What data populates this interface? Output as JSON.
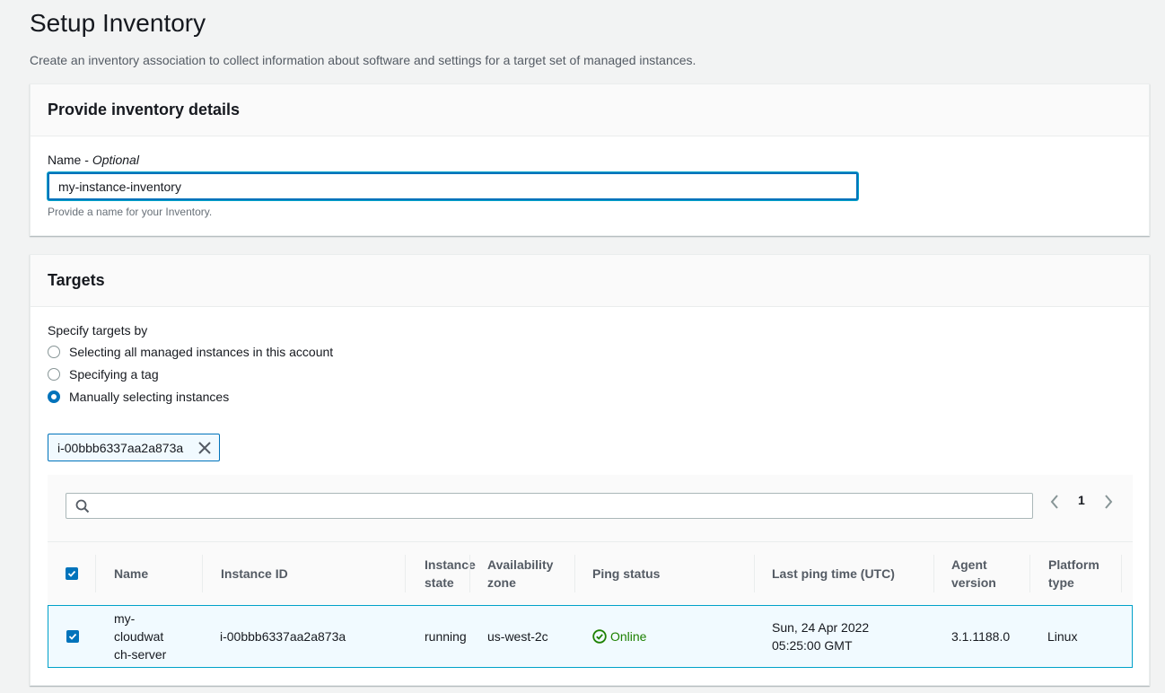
{
  "page": {
    "title": "Setup Inventory",
    "subtitle": "Create an inventory association to collect information about software and settings for a target set of managed instances."
  },
  "details": {
    "header": "Provide inventory details",
    "name_label": "Name",
    "name_label_sep": " - ",
    "name_label_optional": "Optional",
    "name_value": "my-instance-inventory",
    "name_hint": "Provide a name for your Inventory."
  },
  "targets": {
    "header": "Targets",
    "specify_label": "Specify targets by",
    "options": [
      {
        "label": "Selecting all managed instances in this account",
        "checked": false
      },
      {
        "label": "Specifying a tag",
        "checked": false
      },
      {
        "label": "Manually selecting instances",
        "checked": true
      }
    ],
    "token": "i-00bbb6337aa2a873a",
    "pagination": {
      "current_page": "1"
    },
    "table": {
      "columns": [
        "Name",
        "Instance ID",
        "Instance state",
        "Availability zone",
        "Ping status",
        "Last ping time (UTC)",
        "Agent version",
        "Platform type"
      ],
      "rows": [
        {
          "name": "my-cloudwatch-server",
          "instance_id": "i-00bbb6337aa2a873a",
          "state": "running",
          "zone": "us-west-2c",
          "ping": "Online",
          "last_ping": "Sun, 24 Apr 2022 05:25:00 GMT",
          "agent_version": "3.1.1188.0",
          "platform": "Linux",
          "selected": true
        }
      ]
    }
  },
  "icons": {
    "search": "search-icon",
    "close": "close-icon",
    "prev": "chevron-left-icon",
    "next": "chevron-right-icon",
    "check": "check-icon",
    "status_ok": "status-positive-icon"
  },
  "colors": {
    "accent": "#0073bb",
    "success": "#1d8102",
    "selected_row": "#f1faff"
  }
}
